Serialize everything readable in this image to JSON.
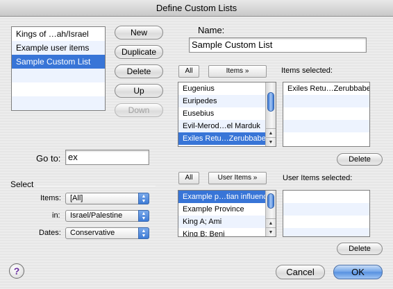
{
  "window": {
    "title": "Define Custom Lists"
  },
  "custom_lists": {
    "items": [
      "Kings of …ah/Israel",
      "Example user items",
      "Sample Custom List"
    ],
    "selected_index": 2
  },
  "list_buttons": {
    "new": "New",
    "duplicate": "Duplicate",
    "delete": "Delete",
    "up": "Up",
    "down": "Down"
  },
  "name": {
    "label": "Name:",
    "value": "Sample Custom List"
  },
  "items_section": {
    "all_button": "All",
    "items_button": "Items »",
    "selected_label": "Items selected:",
    "source": [
      "Eugenius",
      "Euripedes",
      "Eusebius",
      "Evil-Merod…el Marduk",
      "Exiles Retu…Zerubbabel"
    ],
    "source_selected_index": 4,
    "selected": [
      "Exiles Retu…Zerubbabel"
    ],
    "delete_button": "Delete"
  },
  "goto": {
    "label": "Go to:",
    "value": "ex"
  },
  "select": {
    "heading": "Select",
    "items_label": "Items:",
    "items_value": "[All]",
    "in_label": "in:",
    "in_value": "Israel/Palestine",
    "dates_label": "Dates:",
    "dates_value": "Conservative"
  },
  "user_items_section": {
    "all_button": "All",
    "user_items_button": "User Items »",
    "selected_label": "User Items selected:",
    "source": [
      "Example p…tian influence",
      "Example Province",
      "King A; Ami",
      "King B; Beni"
    ],
    "source_selected_index": 0,
    "selected": [],
    "delete_button": "Delete"
  },
  "footer": {
    "help": "?",
    "cancel": "Cancel",
    "ok": "OK"
  },
  "colors": {
    "selection": "#3875d7",
    "default_button": "#5590e0"
  }
}
